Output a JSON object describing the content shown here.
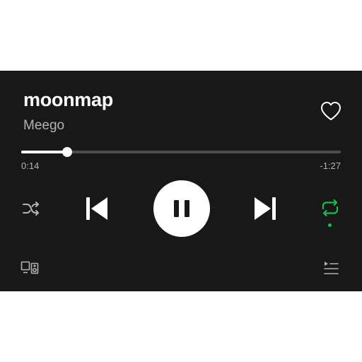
{
  "track": {
    "title": "moonmap",
    "artist": "Meego"
  },
  "playback": {
    "elapsed": "0:14",
    "remaining": "-1:27",
    "progress_fraction": 0.143,
    "state": "playing"
  },
  "controls": {
    "shuffle_icon": "shuffle-icon",
    "previous_icon": "skip-previous-icon",
    "play_pause_icon": "pause-icon",
    "next_icon": "skip-next-icon",
    "repeat_icon": "repeat-icon",
    "repeat_active": true,
    "like_icon": "heart-outline-icon",
    "devices_icon": "connect-devices-icon",
    "queue_icon": "queue-icon"
  },
  "colors": {
    "background": "#181818",
    "text_primary": "#ffffff",
    "text_secondary": "#b3b3b3",
    "accent_green": "#1db954",
    "track_background": "#4d4d4d"
  }
}
